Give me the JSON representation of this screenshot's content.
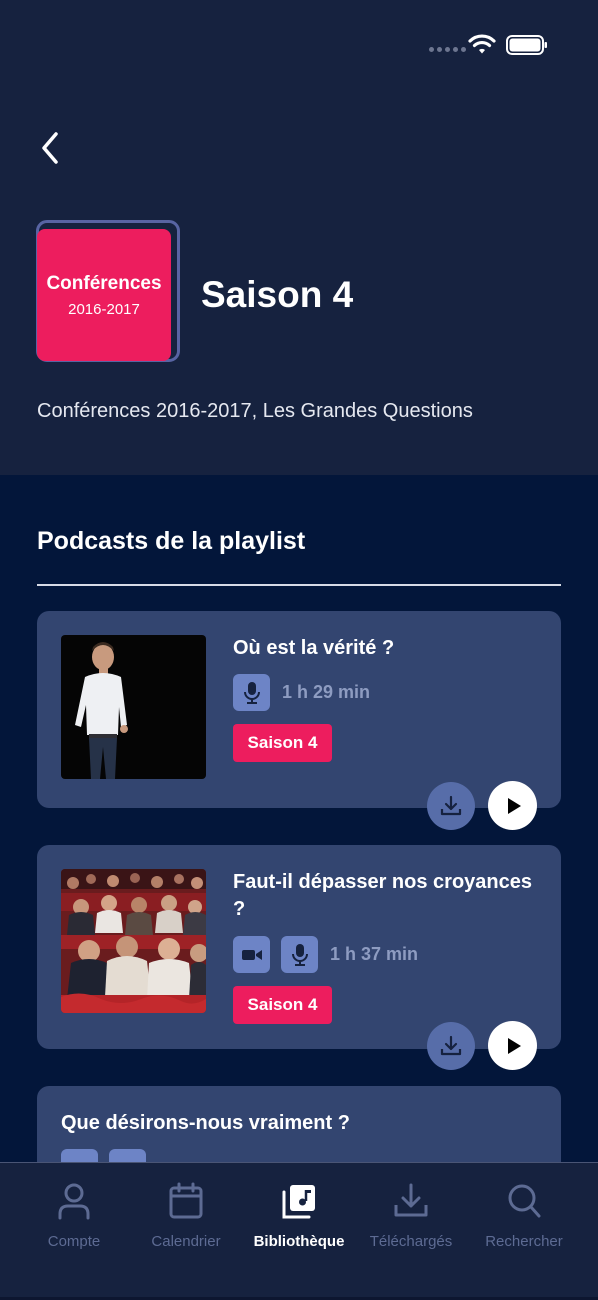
{
  "header": {
    "cover_title": "Conférences",
    "cover_years": "2016-2017",
    "title": "Saison 4",
    "subtitle": "Conférences 2016-2017, Les Grandes Questions"
  },
  "section": {
    "title": "Podcasts de la playlist"
  },
  "podcasts": [
    {
      "title": "Où est la vérité ?",
      "media": [
        "microphone"
      ],
      "duration": "1 h 29 min",
      "badge": "Saison 4"
    },
    {
      "title": "Faut-il dépasser nos croyances ?",
      "media": [
        "video",
        "microphone"
      ],
      "duration": "1 h 37 min",
      "badge": "Saison 4"
    },
    {
      "title": "Que désirons-nous vraiment ?",
      "media": [
        "video",
        "microphone"
      ]
    }
  ],
  "tabs": [
    {
      "label": "Compte",
      "icon": "user-icon",
      "active": false
    },
    {
      "label": "Calendrier",
      "icon": "calendar-icon",
      "active": false
    },
    {
      "label": "Bibliothèque",
      "icon": "library-icon",
      "active": true
    },
    {
      "label": "Téléchargés",
      "icon": "download-icon",
      "active": false
    },
    {
      "label": "Rechercher",
      "icon": "search-icon",
      "active": false
    }
  ],
  "colors": {
    "background": "#03163a",
    "header": "#16223f",
    "card": "#334570",
    "accent": "#ed1d5e",
    "icon_tile": "#6d84c6",
    "muted": "#8e9cc1"
  }
}
